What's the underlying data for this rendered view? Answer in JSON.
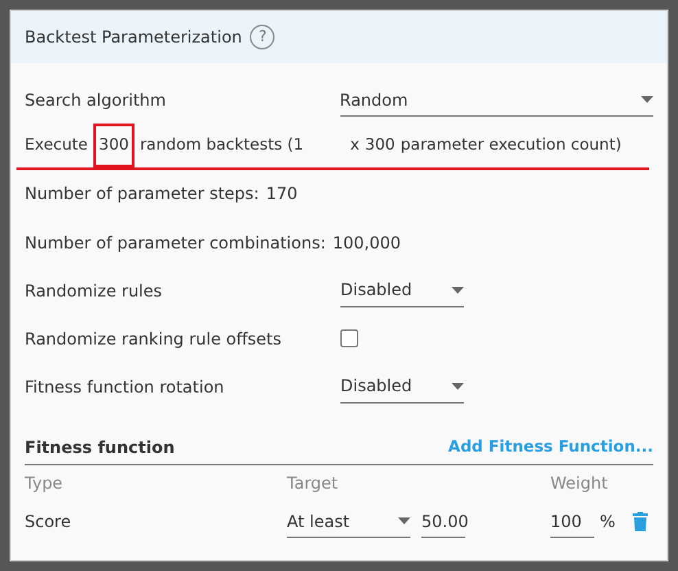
{
  "header": {
    "title": "Backtest Parameterization",
    "help": "?"
  },
  "search_algorithm": {
    "label": "Search algorithm",
    "value": "Random"
  },
  "execute_line": {
    "highlighted": true,
    "parts": [
      {
        "text": "Execute",
        "highlighted": false
      },
      {
        "text": "300",
        "highlighted": true
      },
      {
        "text": "random backtests (1",
        "highlighted": false
      },
      {
        "text": "x",
        "highlighted": false
      },
      {
        "text": "300",
        "highlighted": false
      },
      {
        "text": "parameter execution count)",
        "highlighted": false
      }
    ]
  },
  "stats": [
    {
      "label": "Number of parameter steps:",
      "value": "170"
    },
    {
      "label": "Number of parameter combinations:",
      "value": "100,000"
    }
  ],
  "settings": [
    {
      "kind": "dropdown",
      "label": "Randomize rules",
      "value": "Disabled"
    },
    {
      "kind": "checkbox",
      "label": "Randomize ranking rule offsets",
      "checked": false
    },
    {
      "kind": "dropdown",
      "label": "Fitness function rotation",
      "value": "Disabled"
    }
  ],
  "fitness": {
    "title": "Fitness function",
    "add_link": "Add Fitness Function...",
    "columns": [
      "Type",
      "Target",
      "Weight"
    ],
    "rows": [
      {
        "type": "Score",
        "target": "At least",
        "target_value": "50.00",
        "weight": "100",
        "unit": "%"
      }
    ]
  }
}
